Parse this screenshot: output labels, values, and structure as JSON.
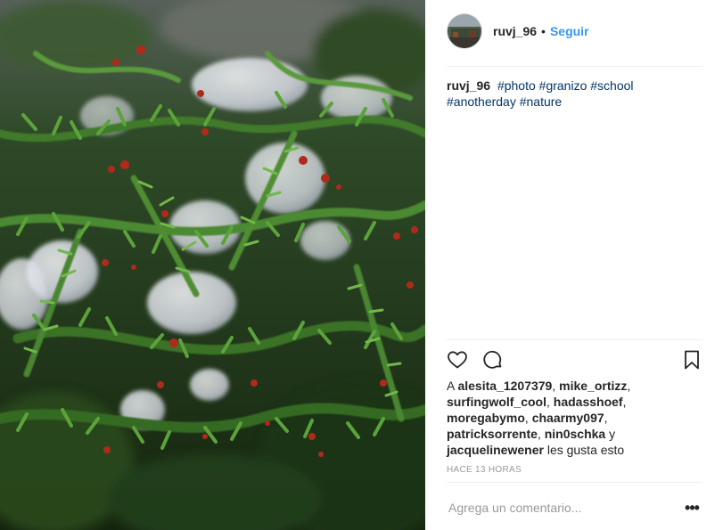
{
  "post": {
    "image_subject": "hail-on-juniper-photo"
  },
  "header": {
    "username": "ruvj_96",
    "separator": "•",
    "follow_label": "Seguir",
    "avatar_icon": "user-avatar"
  },
  "caption": {
    "username": "ruvj_96",
    "hashtags": [
      "#photo",
      "#granizo",
      "#school",
      "#anotherday",
      "#nature"
    ]
  },
  "actions": {
    "like_icon": "heart-icon",
    "comment_icon": "comment-icon",
    "save_icon": "bookmark-icon"
  },
  "likes": {
    "prefix": "A",
    "users": [
      "alesita_1207379",
      "mike_ortizz",
      "surfingwolf_cool",
      "hadasshoef",
      "moregabymo",
      "chaarmy097",
      "patricksorrente",
      "nin0schka"
    ],
    "conjunction": "y",
    "last_user": "jacquelinewener",
    "suffix": "les gusta esto"
  },
  "timestamp": "HACE 13 HORAS",
  "comment": {
    "placeholder": "Agrega un comentario...",
    "more_label": "•••"
  },
  "colors": {
    "accent": "#3897f0",
    "hashtag": "#003569",
    "text": "#262626",
    "muted": "#999999"
  }
}
